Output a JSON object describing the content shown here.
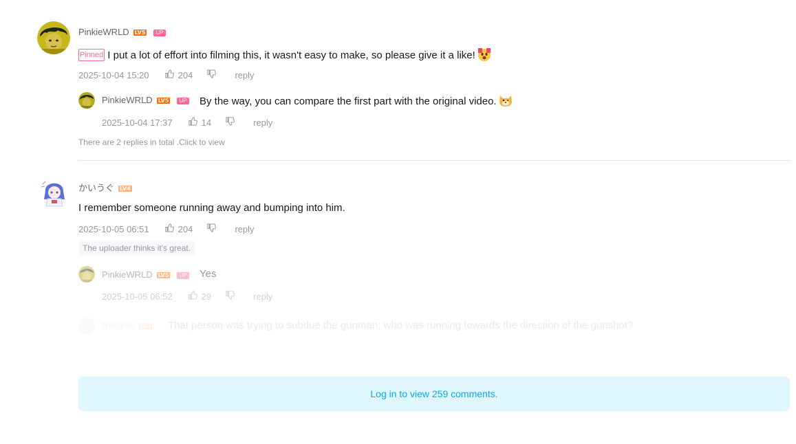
{
  "comments": [
    {
      "username": "PinkieWRLD",
      "level": "LV5",
      "up_badge": "UP",
      "pinned_label": "Pinned",
      "text": "I put a lot of effort into filming this, it wasn't easy to make, so please give it a like!",
      "emoji": "shocked-face",
      "time": "2025-10-04 15:20",
      "likes": "204",
      "reply_label": "reply",
      "replies": [
        {
          "username": "PinkieWRLD",
          "level": "LV5",
          "up_badge": "UP",
          "text": "By the way, you can compare the first part with the original video.",
          "emoji": "dog-face",
          "time": "2025-10-04 17:37",
          "likes": "14",
          "reply_label": "reply"
        }
      ],
      "view_more": "There are 2 replies in total .Click to view"
    },
    {
      "username": "かいうぐ",
      "level": "LV4",
      "text": "I remember someone running away and bumping into him.",
      "time": "2025-10-05 06:51",
      "likes": "204",
      "reply_label": "reply",
      "up_liked_tag": "The uploader thinks it's great.",
      "replies": [
        {
          "username": "PinkieWRLD",
          "level": "LV5",
          "up_badge": "UP",
          "text": "Yes",
          "time": "2025-10-05 06:52",
          "likes": "29",
          "reply_label": "reply"
        },
        {
          "username": "NBBFIN",
          "level": "LV3",
          "text": "That person was trying to subdue the gunman; who was running towards the direction of the gunshot?"
        }
      ]
    }
  ],
  "login_prompt": "Log in to view 259 comments.",
  "colors": {
    "accent": "#00aeec",
    "up_pink": "#ff6699",
    "level5": "#ff6c00",
    "meta_gray": "#9499a0"
  }
}
